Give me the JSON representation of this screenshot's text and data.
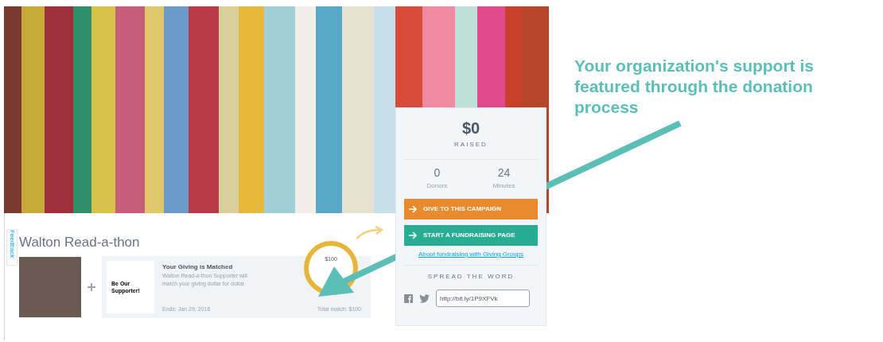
{
  "feedback_tab": "Feedback",
  "campaign": {
    "title": "Walton Read-a-thon"
  },
  "match": {
    "sponsor_logo": "Be Our Supporter!",
    "heading": "Your Giving is Matched",
    "description": "Walton Read-a-thon Supporter will match your giving dollar for dollar.",
    "ends": "Ends: Jan 29, 2016",
    "total": "Total match: $100",
    "ring_amount": "$100"
  },
  "sidebar": {
    "raised": "$0",
    "raised_label": "RAISED",
    "stats": [
      {
        "value": "0",
        "label": "Donors"
      },
      {
        "value": "24",
        "label": "Minutes"
      }
    ],
    "buttons": [
      {
        "kind": "give",
        "label": "GIVE TO THIS CAMPAIGN"
      },
      {
        "kind": "fundraise",
        "label": "START A FUNDRAISING PAGE"
      }
    ],
    "link": "About fundraising with Giving Groups",
    "share_heading": "SPREAD THE WORD",
    "share_url": "http://bit.ly/1P9XFVk"
  },
  "annotation": {
    "text": "Your organization's support is featured through the donation process"
  }
}
